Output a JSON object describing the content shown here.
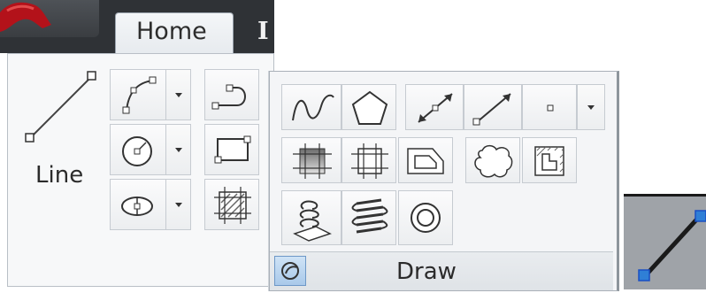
{
  "ribbon": {
    "tabs": [
      {
        "label": "Home",
        "active": true
      },
      {
        "label": "I",
        "active": false
      }
    ],
    "line_tool_label": "Line",
    "panel_title": "Draw"
  },
  "icons": {
    "line": "line-icon",
    "polyline": "polyline-icon",
    "circle": "circle-icon",
    "ellipse": "ellipse-icon",
    "spline": "spline-icon",
    "polygon": "polygon-icon",
    "construction_line": "construction-line-icon",
    "ray": "ray-icon",
    "point": "point-icon",
    "rectangle": "rectangle-icon",
    "hatch": "hatch-icon",
    "gradient": "gradient-icon",
    "boundary": "boundary-icon",
    "region": "region-icon",
    "revision_cloud": "revision-cloud-icon",
    "wipeout": "wipeout-icon",
    "helix_3d": "helix-3d-icon",
    "helix": "helix-icon",
    "donut": "donut-icon",
    "pin": "pin-icon"
  },
  "colors": {
    "grip": "#1a4fc4",
    "grip_light": "#2f7fd6",
    "app_red": "#b3121a"
  }
}
